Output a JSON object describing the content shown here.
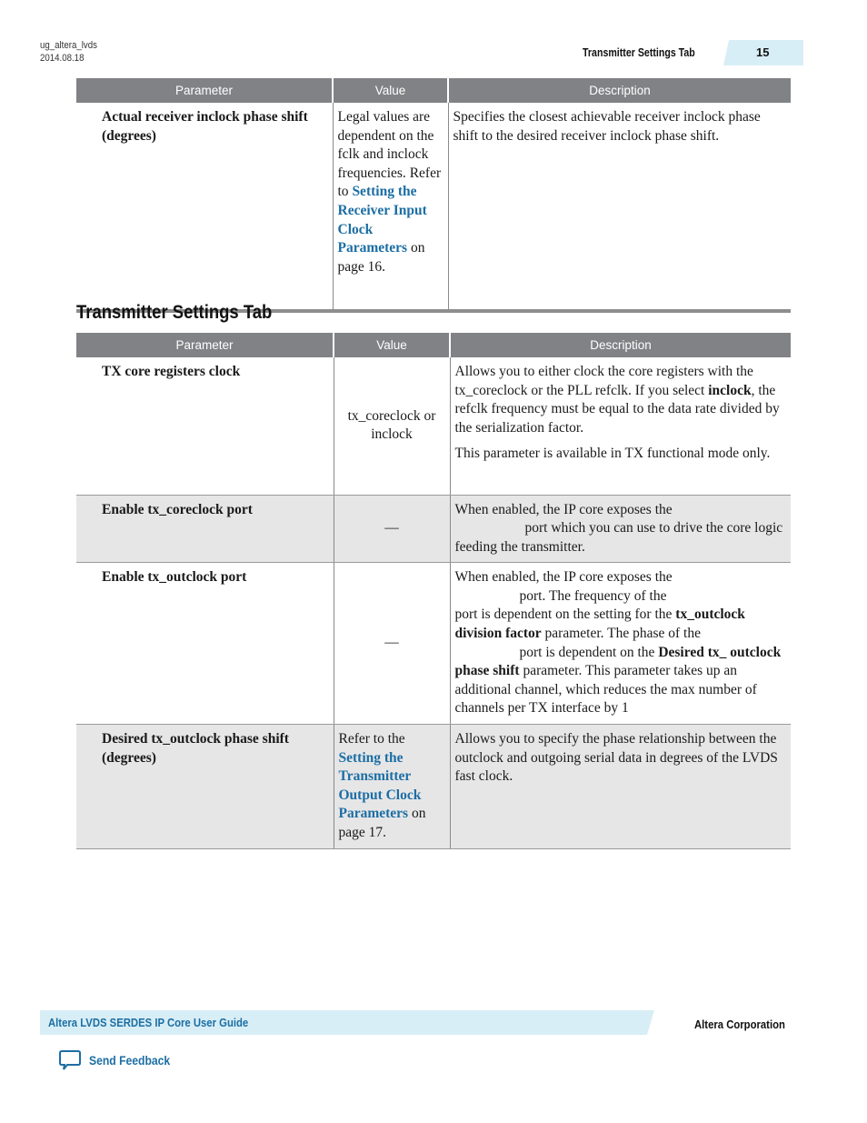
{
  "header": {
    "doc_id": "ug_altera_lvds",
    "date": "2014.08.18",
    "section": "Transmitter Settings Tab",
    "page_number": "15"
  },
  "table_columns": [
    "Parameter",
    "Value",
    "Description"
  ],
  "receiver_table": {
    "rows": [
      {
        "parameter": "Actual receiver inclock phase shift (degrees)",
        "value_text": "Legal values are dependent on the fclk and inclock frequencies.",
        "value_refer": "Refer to",
        "value_link": "Setting the Receiver Input Clock Parameters",
        "value_suffix": "on page 16.",
        "description": "Specifies the closest achievable receiver inclock phase shift to the desired receiver inclock phase shift."
      }
    ]
  },
  "section_title": "Transmitter Settings Tab",
  "transmitter_table": {
    "rows": [
      {
        "parameter": "TX core registers clock",
        "value": "tx_coreclock or inclock",
        "description_1_a": "Allows you to either clock the core registers with the tx_coreclock or the PLL refclk. If you select",
        "description_1_bold": "inclock",
        "description_1_b": ", the refclk frequency must be equal to the data rate divided by the serialization factor.",
        "description_2": "This parameter is available in TX functional mode only."
      },
      {
        "parameter": "Enable tx_coreclock port",
        "value": "—",
        "description_a": "When enabled, the IP core exposes the",
        "description_b": "port which you can use to drive the core logic feeding the transmitter."
      },
      {
        "parameter": "Enable tx_outclock port",
        "value": "—",
        "description_a": "When enabled, the IP core exposes the",
        "description_b": "port. The frequency of the",
        "description_c": "port is dependent on the setting for the",
        "description_bold_1": "tx_outclock division factor",
        "description_d": "parameter. The phase of the",
        "description_e": "port is dependent on the",
        "description_bold_2": "Desired tx_ outclock phase shift",
        "description_f": "parameter. This parameter takes up an additional channel, which reduces the max number of channels per TX interface by 1"
      },
      {
        "parameter": "Desired tx_outclock phase shift (degrees)",
        "value_refer": "Refer to the",
        "value_link": "Setting the Transmitter Output Clock Parameters",
        "value_suffix": "on page 17.",
        "description": "Allows you to specify the phase relationship between the outclock and outgoing serial data in degrees of the LVDS fast clock."
      }
    ]
  },
  "footer": {
    "guide_title": "Altera LVDS SERDES IP Core User Guide",
    "company": "Altera Corporation",
    "feedback_label": "Send Feedback",
    "feedback_icon": "speech-bubble-icon"
  },
  "colors": {
    "accent_blue": "#1c6ea4",
    "header_band": "#d8eef6",
    "table_header": "#808285",
    "row_shade": "#e6e6e7"
  }
}
